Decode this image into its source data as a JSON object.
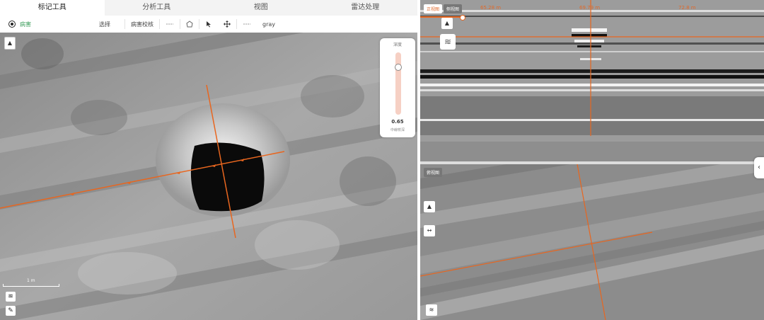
{
  "tabs": [
    {
      "label": "标记工具",
      "active": true
    },
    {
      "label": "分析工具",
      "active": false
    },
    {
      "label": "视图",
      "active": false
    },
    {
      "label": "雷达处理",
      "active": false
    }
  ],
  "toolbar": {
    "disease_label": "病害",
    "select_label": "选择",
    "disease_check_label": "病害校核",
    "colormap_label": "gray"
  },
  "depth_panel": {
    "title": "深度",
    "value": "0.65",
    "caption": "中線校深",
    "level_fraction": 0.18
  },
  "scale_bar": {
    "label": "1 m"
  },
  "right_top": {
    "tabs": [
      {
        "label": "正视图",
        "active": true
      },
      {
        "label": "侧视图",
        "active": false
      }
    ],
    "top_labels": [
      "65.28 m",
      "69.79 m",
      "72.8 m"
    ]
  },
  "right_bottom": {
    "label": "俯视图"
  },
  "colors": {
    "accent": "#e06a2c",
    "marker_line": "#e8661f"
  },
  "icons": [
    "north-arrow-icon",
    "layers-icon",
    "pencil-icon",
    "measure-icon",
    "polygon-icon",
    "pointer-icon",
    "move-icon",
    "chevron-left-icon"
  ]
}
